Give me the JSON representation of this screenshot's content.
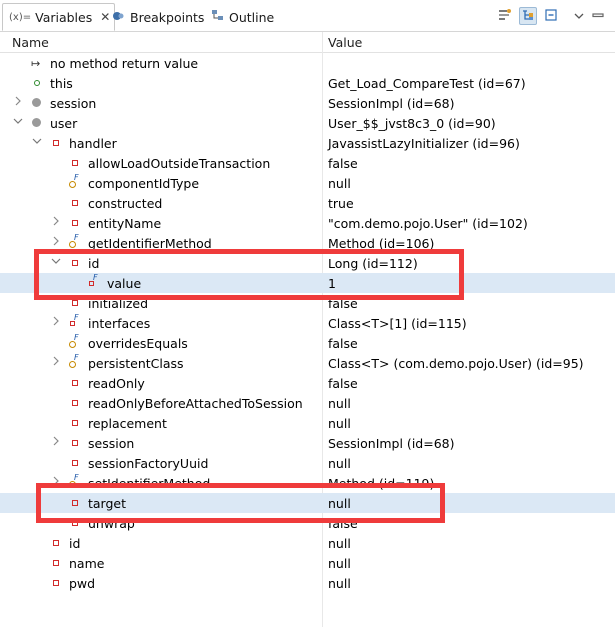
{
  "tabs": [
    {
      "label": "Variables",
      "prefix": "(x)=",
      "active": true,
      "close": "✕"
    },
    {
      "label": "Breakpoints"
    },
    {
      "label": "Outline"
    }
  ],
  "columns": {
    "name": "Name",
    "value": "Value"
  },
  "rows": [
    {
      "name": "no method return value",
      "value": "",
      "icon": "return-icon",
      "indent": 0,
      "twisty": ""
    },
    {
      "name": "this",
      "value": "Get_Load_CompareTest  (id=67)",
      "icon": "green-circle-icon",
      "indent": 0,
      "twisty": ""
    },
    {
      "name": "session",
      "value": "SessionImpl  (id=68)",
      "icon": "gray-circle-icon",
      "indent": 0,
      "twisty": "collapsed"
    },
    {
      "name": "user",
      "value": "User_$$_jvst8c3_0  (id=90)",
      "icon": "gray-circle-icon",
      "indent": 0,
      "twisty": "expanded"
    },
    {
      "name": "handler",
      "value": "JavassistLazyInitializer  (id=96)",
      "icon": "red-square-icon",
      "indent": 1,
      "twisty": "expanded"
    },
    {
      "name": "allowLoadOutsideTransaction",
      "value": "false",
      "icon": "red-square-icon",
      "indent": 2,
      "twisty": ""
    },
    {
      "name": "componentIdType",
      "value": "null",
      "icon": "orange-final-icon",
      "indent": 2,
      "twisty": ""
    },
    {
      "name": "constructed",
      "value": "true",
      "icon": "red-square-icon",
      "indent": 2,
      "twisty": ""
    },
    {
      "name": "entityName",
      "value": "\"com.demo.pojo.User\" (id=102)",
      "icon": "red-square-icon",
      "indent": 2,
      "twisty": "collapsed"
    },
    {
      "name": "getIdentifierMethod",
      "value": "Method  (id=106)",
      "icon": "orange-final-icon",
      "indent": 2,
      "twisty": "collapsed"
    },
    {
      "name": "id",
      "value": "Long  (id=112)",
      "icon": "red-square-icon",
      "indent": 2,
      "twisty": "expanded"
    },
    {
      "name": "value",
      "value": "1",
      "icon": "red-final-icon",
      "indent": 3,
      "twisty": "",
      "selected": true
    },
    {
      "name": "initialized",
      "value": "false",
      "icon": "red-square-icon",
      "indent": 2,
      "twisty": ""
    },
    {
      "name": "interfaces",
      "value": "Class<T>[1]  (id=115)",
      "icon": "red-final-icon",
      "indent": 2,
      "twisty": "collapsed"
    },
    {
      "name": "overridesEquals",
      "value": "false",
      "icon": "orange-final-icon",
      "indent": 2,
      "twisty": ""
    },
    {
      "name": "persistentClass",
      "value": "Class<T> (com.demo.pojo.User) (id=95)",
      "icon": "orange-final-icon",
      "indent": 2,
      "twisty": "collapsed"
    },
    {
      "name": "readOnly",
      "value": "false",
      "icon": "red-square-icon",
      "indent": 2,
      "twisty": ""
    },
    {
      "name": "readOnlyBeforeAttachedToSession",
      "value": "null",
      "icon": "red-square-icon",
      "indent": 2,
      "twisty": ""
    },
    {
      "name": "replacement",
      "value": "null",
      "icon": "red-square-icon",
      "indent": 2,
      "twisty": ""
    },
    {
      "name": "session",
      "value": "SessionImpl  (id=68)",
      "icon": "red-square-icon",
      "indent": 2,
      "twisty": "collapsed"
    },
    {
      "name": "sessionFactoryUuid",
      "value": "null",
      "icon": "red-square-icon",
      "indent": 2,
      "twisty": ""
    },
    {
      "name": "setIdentifierMethod",
      "value": "Method  (id=119)",
      "icon": "orange-final-icon",
      "indent": 2,
      "twisty": "collapsed"
    },
    {
      "name": "target",
      "value": "null",
      "icon": "red-square-icon",
      "indent": 2,
      "twisty": "",
      "selected": true
    },
    {
      "name": "unwrap",
      "value": "false",
      "icon": "red-square-icon",
      "indent": 2,
      "twisty": ""
    },
    {
      "name": "id",
      "value": "null",
      "icon": "red-square-icon",
      "indent": 1,
      "twisty": ""
    },
    {
      "name": "name",
      "value": "null",
      "icon": "red-square-icon",
      "indent": 1,
      "twisty": ""
    },
    {
      "name": "pwd",
      "value": "null",
      "icon": "red-square-icon",
      "indent": 1,
      "twisty": ""
    }
  ],
  "colors": {
    "highlight_box": "#ef3b3b",
    "selection": "#dbe8f5"
  }
}
